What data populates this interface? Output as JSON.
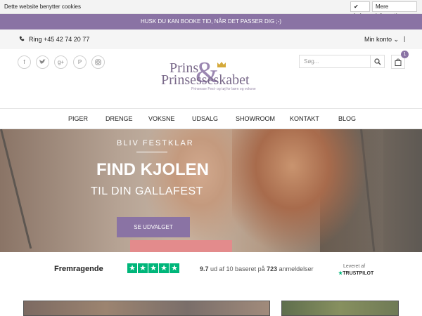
{
  "cookie_bar": {
    "text": "Dette website benytter cookies",
    "close_label": "✔ Luk",
    "more_label": "Mere information"
  },
  "promo": {
    "text": "HUSK DU KAN BOOKE TID, NÅR DET PASSER DIG ;-)"
  },
  "topbar": {
    "phone": "Ring +45 42 74 20 77",
    "account": "Min konto ⌄",
    "separator": "|"
  },
  "header": {
    "logo_line1": "Prins",
    "logo_amp": "&",
    "logo_line2": "Prinsesseskabet",
    "logo_tagline": "Prinsesse Fest- og tøj for børn og voksne",
    "search_placeholder": "Søg...",
    "cart_count": "1",
    "socials": [
      "facebook-icon",
      "twitter-icon",
      "google-plus-icon",
      "pinterest-icon",
      "instagram-icon"
    ]
  },
  "nav": {
    "items": [
      "PIGER",
      "DRENGE",
      "VOKSNE",
      "UDSALG",
      "SHOWROOM",
      "KONTAKT",
      "BLOG"
    ]
  },
  "hero": {
    "kicker": "BLIV FESTKLAR",
    "title": "FIND KJOLEN",
    "subtitle": "TIL DIN GALLAFEST",
    "button": "SE UDVALGET"
  },
  "trustpilot": {
    "label": "Fremragende",
    "rating": "9.7",
    "score_text_a": "ud af 10 baseret på",
    "reviews": "723",
    "score_text_b": "anmeldelser",
    "delivered_by": "Leveret af",
    "brand": "TRUSTPILOT",
    "stars": 5
  },
  "colors": {
    "accent": "#8a73a4",
    "trust_green": "#00b67a"
  }
}
